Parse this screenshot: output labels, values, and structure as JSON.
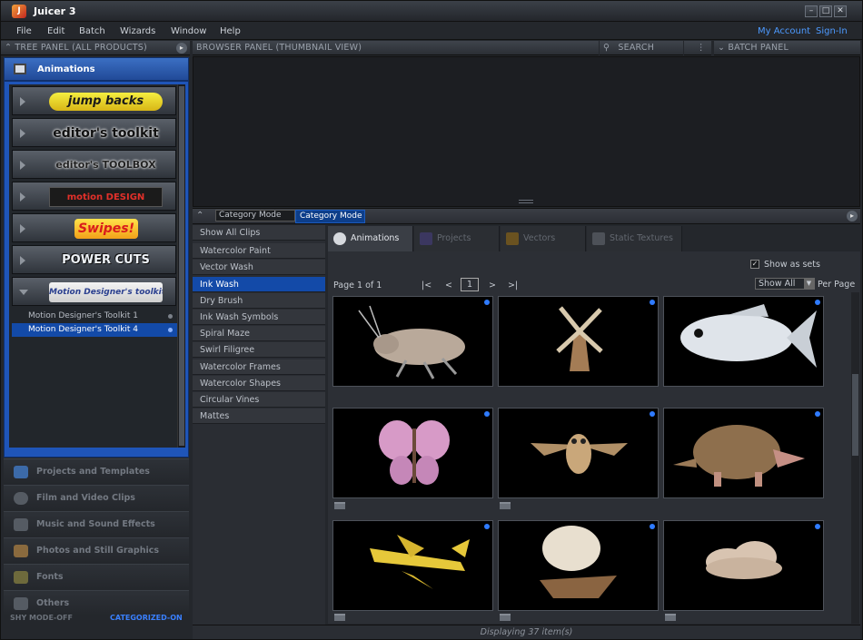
{
  "window": {
    "title": "Juicer 3"
  },
  "menu": [
    "File",
    "Edit",
    "Batch",
    "Wizards",
    "Window",
    "Help"
  ],
  "account": {
    "my_account": "My Account",
    "sign_in": "Sign-In"
  },
  "headers": {
    "tree": "TREE PANEL (ALL PRODUCTS)",
    "browser": "BROWSER PANEL (THUMBNAIL VIEW)",
    "search": "SEARCH",
    "batch": "BATCH PANEL"
  },
  "tree": {
    "selected_category": "Animations",
    "products": [
      "jump backs",
      "editor's toolkit",
      "editor's TOOLBOX",
      "motion DESIGN ELEMENTS",
      "Swipes!",
      "POWER CUTS",
      "Motion Designer's toolkit"
    ],
    "subitems": [
      "Motion Designer's Toolkit 1",
      "Motion Designer's Toolkit 4"
    ],
    "categories": [
      "Projects and Templates",
      "Film and Video Clips",
      "Music and Sound Effects",
      "Photos and Still Graphics",
      "Fonts",
      "Others"
    ],
    "modes": {
      "shy": "SHY MODE-OFF",
      "categorized": "CATEGORIZED-ON"
    }
  },
  "mode": {
    "value": "Category Mode",
    "tooltip": "Category Mode"
  },
  "clip_list": [
    "Show All Clips",
    "Watercolor Paint",
    "Vector Wash",
    "Ink Wash",
    "Dry Brush",
    "Ink Wash Symbols",
    "Spiral Maze",
    "Swirl Filigree",
    "Watercolor Frames",
    "Watercolor Shapes",
    "Circular Vines",
    "Mattes"
  ],
  "tabs": [
    "Animations",
    "Projects",
    "Vectors",
    "Static Textures"
  ],
  "options": {
    "show_as_sets": "Show as sets",
    "show_all": "Show All",
    "per_page": "Per Page"
  },
  "pager": {
    "label": "Page 1 of 1",
    "first": "|<",
    "prev": "<",
    "current": "1",
    "next": ">",
    "last": ">|"
  },
  "thumbnails": [
    "insect",
    "windmill",
    "fish",
    "butterfly",
    "owl",
    "armadillo",
    "airplane",
    "airship",
    "cloud"
  ],
  "status": "Displaying 37 item(s)",
  "colors": {
    "accent": "#134aa8",
    "link": "#4d9aff",
    "tree_blue": "#1f55b8"
  }
}
